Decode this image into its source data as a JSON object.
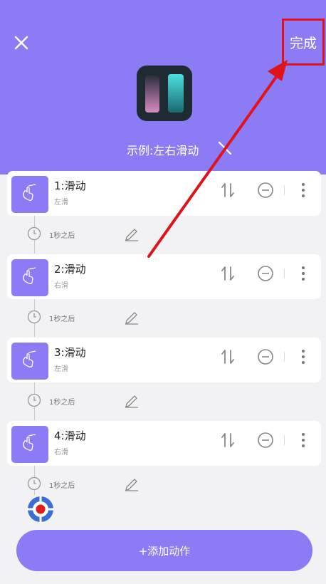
{
  "header": {
    "close_icon": "close-icon",
    "done_label": "完成",
    "script_name": "示例:左右滑动",
    "accent_color": "#8b7cf6",
    "highlight_color": "#e0121b"
  },
  "actions": [
    {
      "title": "1:滑动",
      "subtitle": "左滑",
      "delay": "1秒之后"
    },
    {
      "title": "2:滑动",
      "subtitle": "右滑",
      "delay": "1秒之后"
    },
    {
      "title": "3:滑动",
      "subtitle": "左滑",
      "delay": "1秒之后"
    },
    {
      "title": "4:滑动",
      "subtitle": "右滑",
      "delay": "1秒之后"
    }
  ],
  "footer": {
    "add_label": "+添加动作"
  }
}
